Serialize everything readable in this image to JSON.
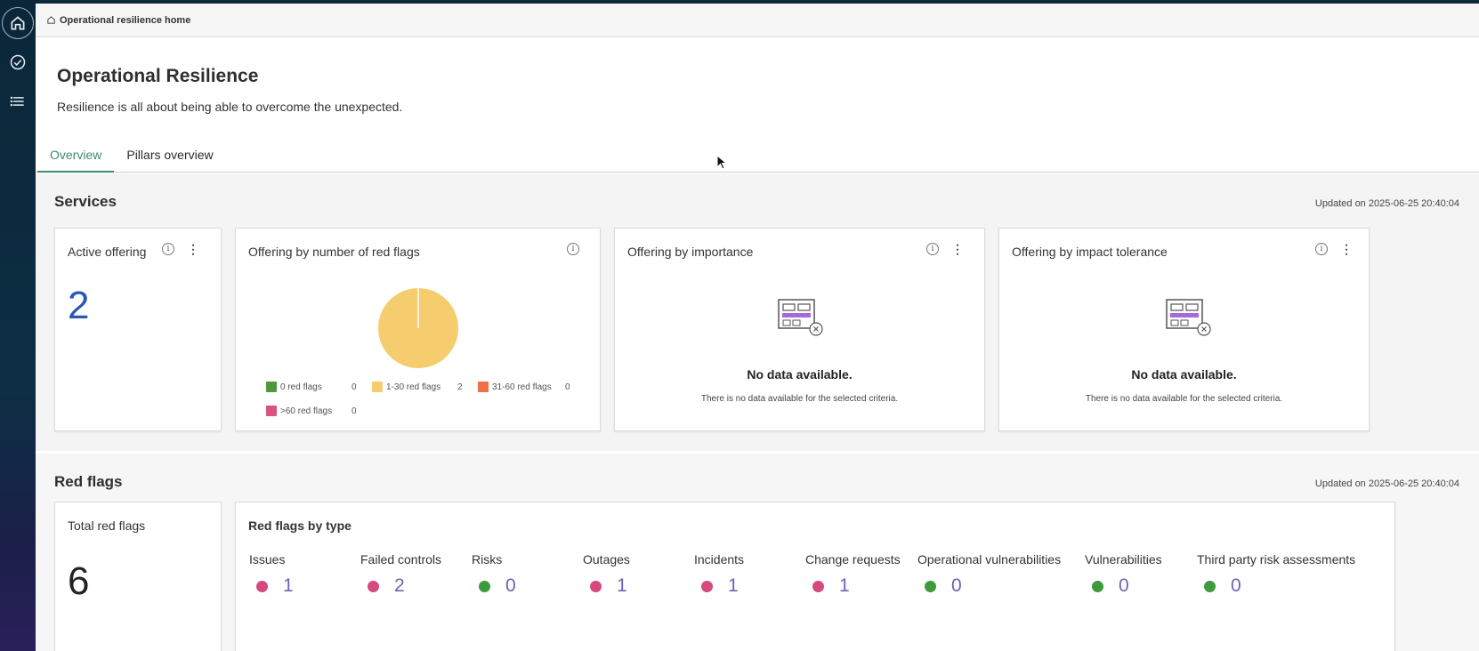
{
  "breadcrumb": {
    "label": "Operational resilience home"
  },
  "page": {
    "title": "Operational Resilience",
    "subtitle": "Resilience is all about being able to overcome the unexpected."
  },
  "tabs": [
    {
      "label": "Overview",
      "active": true
    },
    {
      "label": "Pillars overview",
      "active": false
    }
  ],
  "rail": {
    "icons": [
      "home-icon",
      "check-circle-icon",
      "menu-icon"
    ]
  },
  "services": {
    "title": "Services",
    "updated": "Updated on 2025-06-25 20:40:04",
    "active_offering": {
      "title": "Active offering",
      "value": "2"
    },
    "red_flags_chart": {
      "title": "Offering by number of red flags",
      "legend": [
        {
          "label": "0 red flags",
          "value": "0",
          "color": "#4c9a3a"
        },
        {
          "label": "1-30 red flags",
          "value": "2",
          "color": "#f6cd6e"
        },
        {
          "label": "31-60 red flags",
          "value": "0",
          "color": "#ee7046"
        },
        {
          "label": ">60 red flags",
          "value": "0",
          "color": "#d9537e"
        }
      ]
    },
    "importance": {
      "title": "Offering by importance",
      "nodata_title": "No data available.",
      "nodata_sub": "There is no data available for the selected criteria."
    },
    "impact_tolerance": {
      "title": "Offering by impact tolerance",
      "nodata_title": "No data available.",
      "nodata_sub": "There is no data available for the selected criteria."
    }
  },
  "chart_data": {
    "type": "pie",
    "categories": [
      "0 red flags",
      "1-30 red flags",
      "31-60 red flags",
      ">60 red flags"
    ],
    "values": [
      0,
      2,
      0,
      0
    ],
    "colors": [
      "#4c9a3a",
      "#f6cd6e",
      "#ee7046",
      "#d9537e"
    ],
    "legend": "bottom"
  },
  "red_flags": {
    "title": "Red flags",
    "updated": "Updated on 2025-06-25 20:40:04",
    "total": {
      "title": "Total red flags",
      "value": "6"
    },
    "by_type": {
      "title": "Red flags by type",
      "items": [
        {
          "label": "Issues",
          "value": "1",
          "status": "pink"
        },
        {
          "label": "Failed controls",
          "value": "2",
          "status": "pink"
        },
        {
          "label": "Risks",
          "value": "0",
          "status": "green"
        },
        {
          "label": "Outages",
          "value": "1",
          "status": "pink"
        },
        {
          "label": "Incidents",
          "value": "1",
          "status": "pink"
        },
        {
          "label": "Change requests",
          "value": "1",
          "status": "pink"
        },
        {
          "label": "Operational vulnerabilities",
          "value": "0",
          "status": "green"
        },
        {
          "label": "Vulnerabilities",
          "value": "0",
          "status": "green"
        },
        {
          "label": "Third party risk assessments",
          "value": "0",
          "status": "green"
        }
      ]
    }
  }
}
